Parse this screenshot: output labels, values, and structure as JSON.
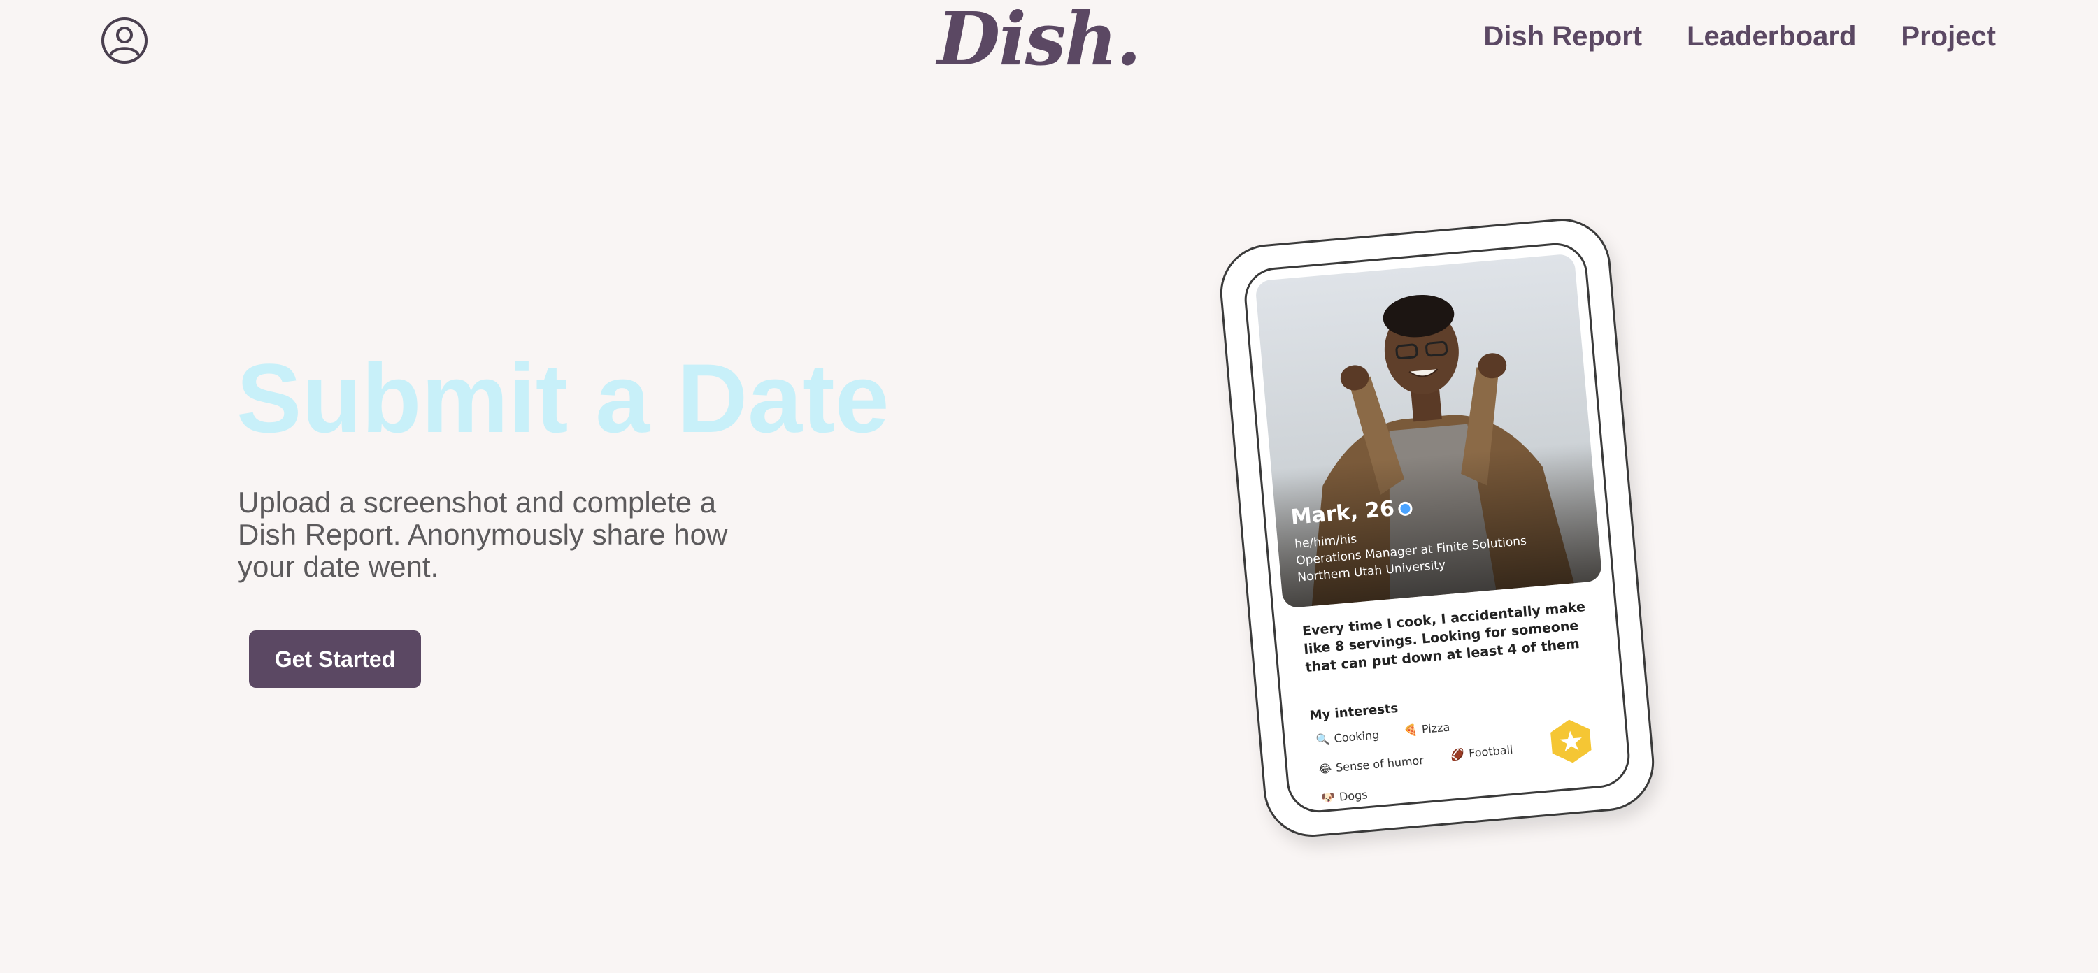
{
  "header": {
    "logo_text": "Dish.",
    "account_icon": "user-circle-icon",
    "nav": [
      {
        "label": "Dish Report"
      },
      {
        "label": "Leaderboard"
      },
      {
        "label": "Project"
      }
    ]
  },
  "hero": {
    "title": "Submit a Date",
    "description": "Upload a screenshot and complete a Dish Report. Anonymously share how your date went.",
    "cta_label": "Get Started"
  },
  "profile_card": {
    "name": "Mark, 26",
    "pronouns": "he/him/his",
    "job": "Operations Manager at Finite Solutions",
    "school": "Northern Utah University",
    "bio": "Every time I cook, I accidentally make like 8 servings. Looking for someone that can put down at least 4 of them",
    "interests_title": "My interests",
    "interests": [
      {
        "label": "Cooking",
        "icon": "magnifier-icon"
      },
      {
        "label": "Pizza",
        "icon": "pizza-icon"
      },
      {
        "label": "Sense of humor",
        "icon": "laughing-icon"
      },
      {
        "label": "Football",
        "icon": "football-icon"
      },
      {
        "label": "Dogs",
        "icon": "dog-icon"
      }
    ],
    "badge_icon": "star-hexagon-icon"
  },
  "colors": {
    "background": "#f9f5f4",
    "brand": "#5b4863",
    "hero_title": "#c8f0f9",
    "badge": "#f5c634"
  }
}
